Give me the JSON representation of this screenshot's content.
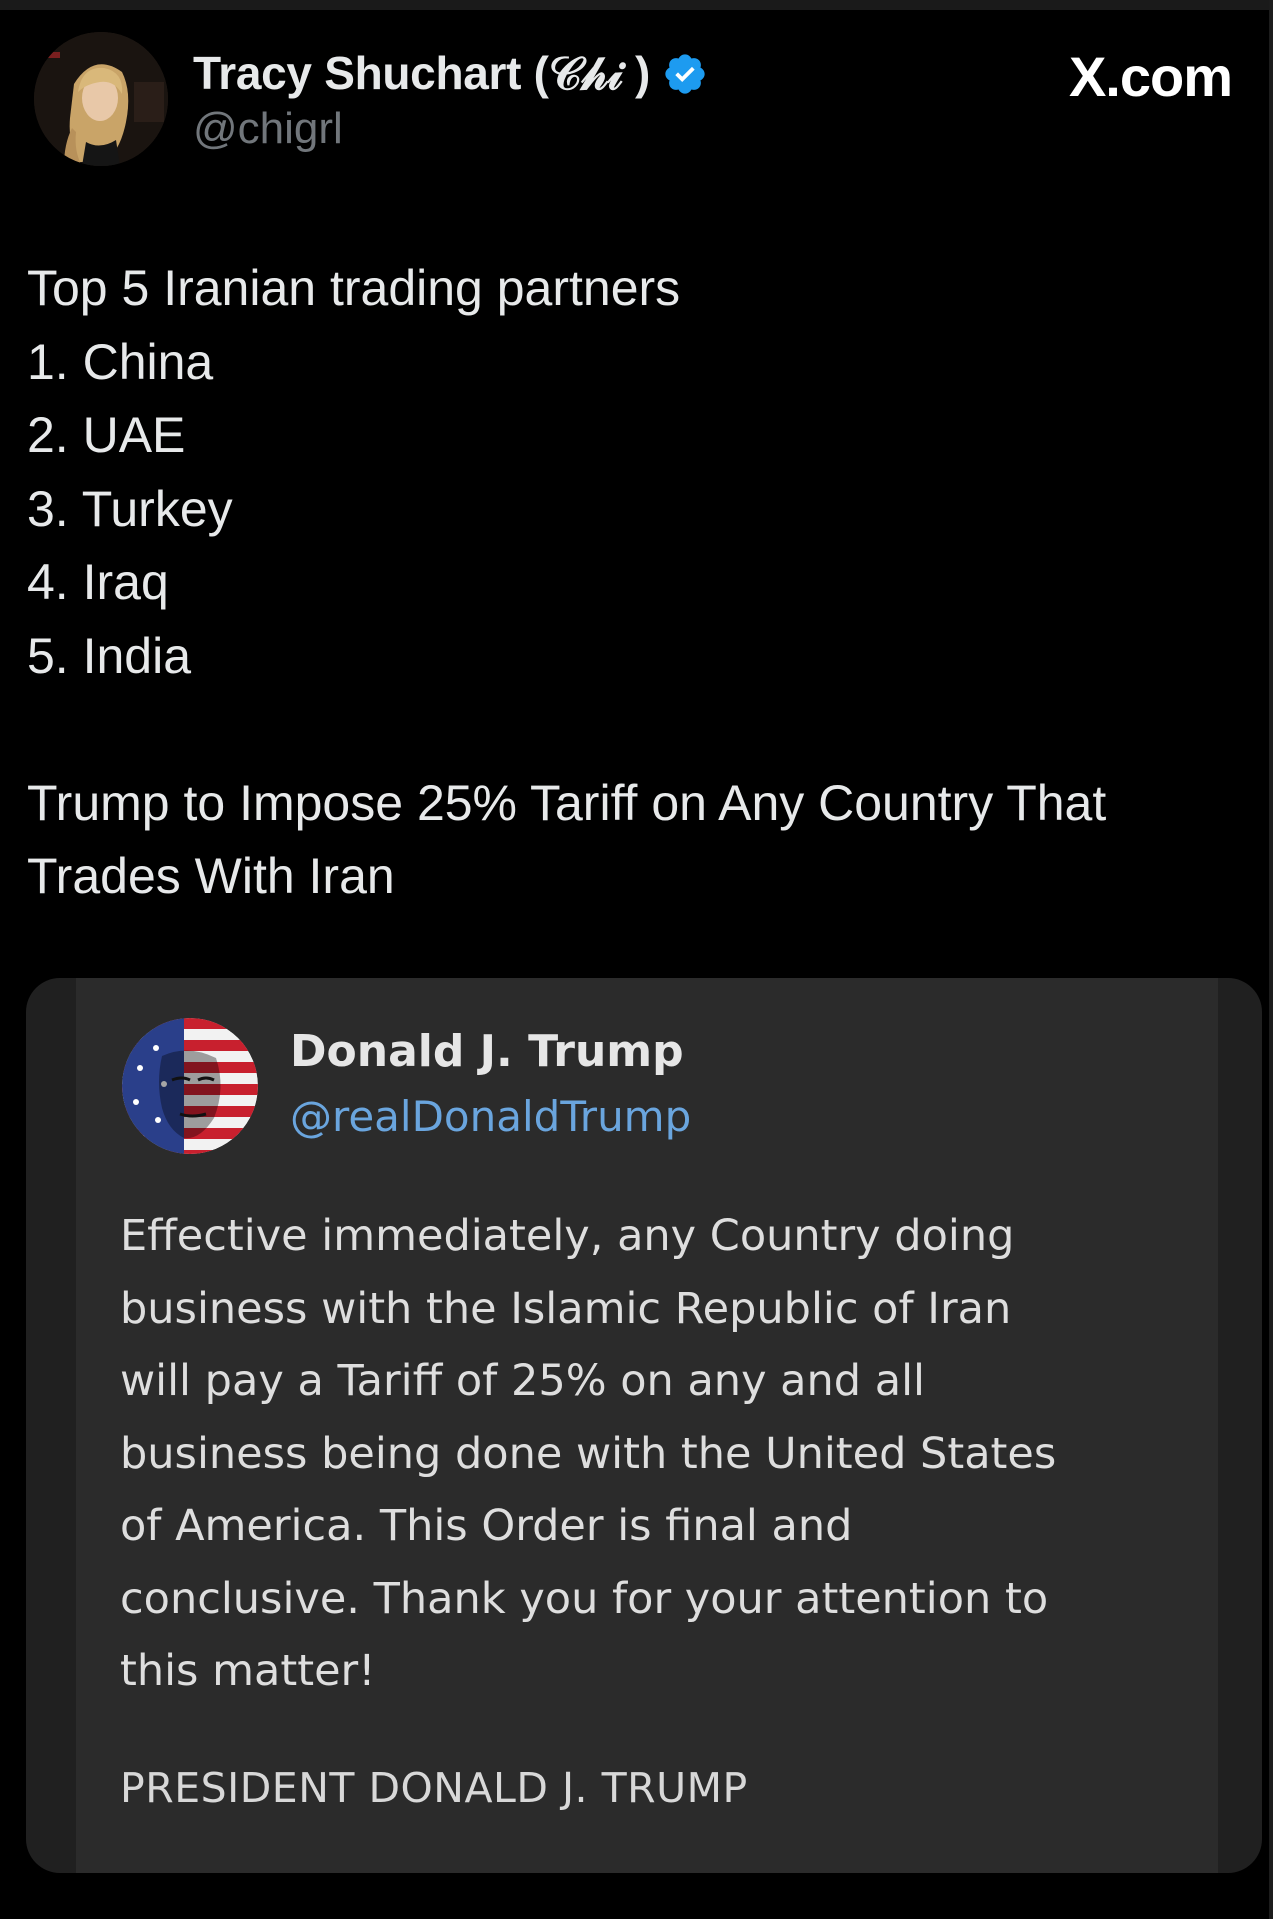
{
  "post": {
    "author_name": "Tracy Shuchart (𝒞𝒽𝒾 )",
    "author_handle": "@chigrl",
    "brand": "X.com",
    "verified": true,
    "text_lines": [
      "Top 5 Iranian trading partners",
      "1. China",
      "2. UAE",
      "3. Turkey",
      "4. Iraq",
      "5. India"
    ],
    "headline_lines": [
      "Trump to Impose 25% Tariff on Any Country That",
      "Trades With Iran"
    ]
  },
  "quote": {
    "author_name": "Donald J. Trump",
    "author_handle": "@realDonaldTrump",
    "body_lines": [
      "Effective immediately, any Country doing",
      "business with the Islamic Republic of Iran",
      "will pay a Tariff of 25% on any and all",
      "business being done with the United States",
      "of America. This Order is final and",
      "conclusive. Thank you for your attention to",
      "this matter!"
    ],
    "signature": "PRESIDENT DONALD J. TRUMP"
  },
  "colors": {
    "background": "#000000",
    "text": "#e7e9ea",
    "handle": "#71767b",
    "verified_badge": "#1d9bf0",
    "quote_handle": "#6aa5de"
  },
  "icons": {
    "verified": "verified-badge-icon",
    "brand_logo": "x-logo"
  }
}
